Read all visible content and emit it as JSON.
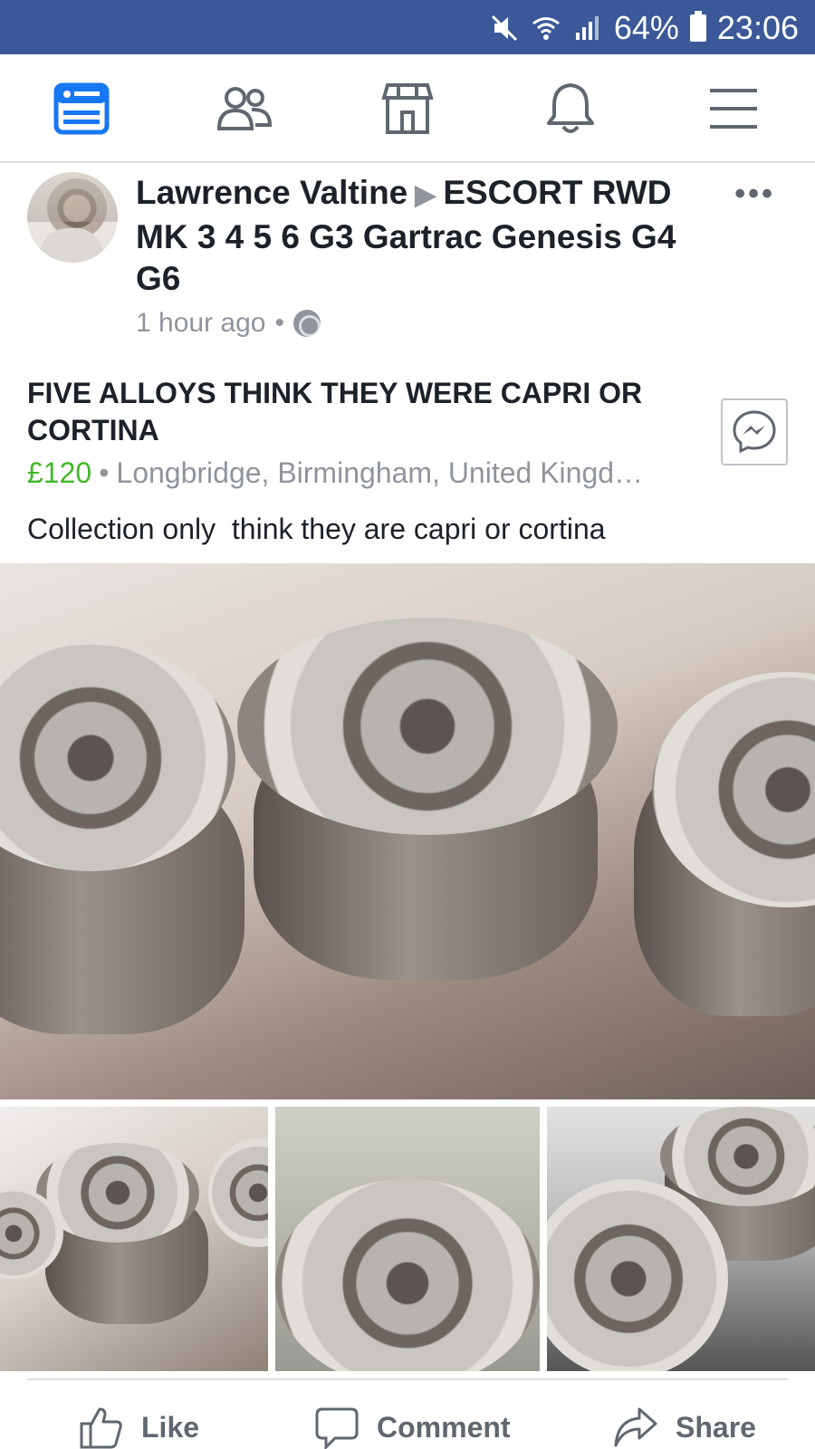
{
  "status_bar": {
    "battery": "64%",
    "time": "23:06",
    "icons": [
      "mute-icon",
      "wifi-icon",
      "signal-icon",
      "battery-icon"
    ]
  },
  "nav": {
    "items": [
      {
        "name": "news-feed-icon",
        "active": true
      },
      {
        "name": "friends-icon",
        "active": false
      },
      {
        "name": "marketplace-icon",
        "active": false
      },
      {
        "name": "notifications-icon",
        "active": false
      },
      {
        "name": "menu-icon",
        "active": false
      }
    ],
    "active_color": "#1877f2",
    "inactive_color": "#606770"
  },
  "post": {
    "author": "Lawrence Valtine",
    "group": "ESCORT RWD MK 3 4 5 6  G3 Gartrac Genesis G4 G6",
    "time": "1 hour ago",
    "separator": "•",
    "privacy_icon": "globe-icon"
  },
  "listing": {
    "title": "FIVE ALLOYS THINK THEY WERE CAPRI OR CORTINA",
    "price": "£120",
    "location": "Longbridge, Birmingham, United Kingd…",
    "description": "Collection only  think they are capri or cortina"
  },
  "actions": {
    "like": "Like",
    "comment": "Comment",
    "share": "Share"
  },
  "colors": {
    "status_bar": "#3b5998",
    "price": "#42b72a",
    "secondary_text": "#90949c"
  }
}
